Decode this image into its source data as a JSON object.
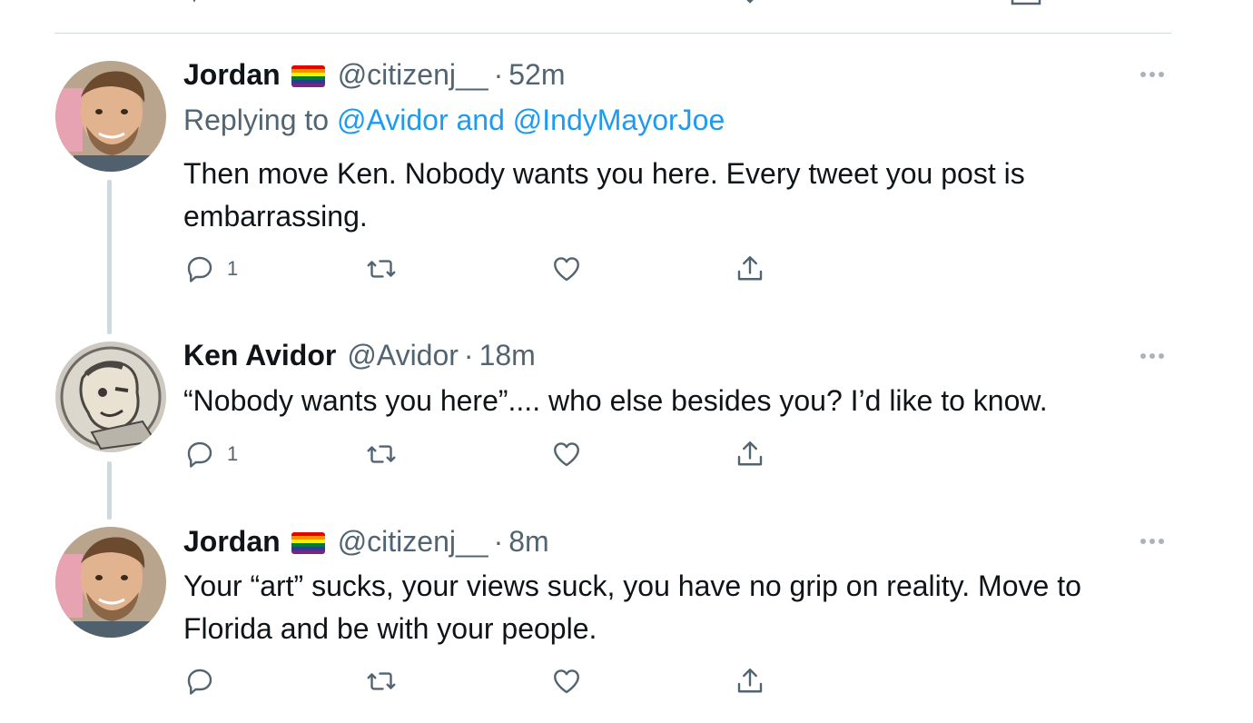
{
  "tweets": [
    {
      "name": "Jordan",
      "flag_icon": "rainbow-flag-icon",
      "handle": "@citizenj__",
      "dot": "·",
      "time": "52m",
      "reply_prefix": "Replying to ",
      "reply_users": "@Avidor and @IndyMayorJoe",
      "text": "Then move Ken. Nobody wants you here. Every tweet you post is embarrassing.",
      "reply_count": "1",
      "retweet_count": "",
      "like_count": ""
    },
    {
      "name": "Ken Avidor",
      "handle": "@Avidor",
      "dot": "·",
      "time": "18m",
      "text": "“Nobody wants you here”.... who else besides you? I’d like to know.",
      "reply_count": "1",
      "retweet_count": "",
      "like_count": ""
    },
    {
      "name": "Jordan",
      "flag_icon": "rainbow-flag-icon",
      "handle": "@citizenj__",
      "dot": "·",
      "time": "8m",
      "text": "Your “art” sucks, your views suck, you have no grip on reality. Move to Florida and be with your people.",
      "reply_count": "",
      "retweet_count": "",
      "like_count": ""
    }
  ],
  "colors": {
    "link": "#1d9bf0",
    "secondary_text": "#536471",
    "divider": "#cfd9de",
    "primary_text": "#0f1419"
  },
  "icons": {
    "reply": "reply-icon",
    "retweet": "retweet-icon",
    "like": "heart-icon",
    "share": "share-icon",
    "more": "more-options-icon"
  }
}
